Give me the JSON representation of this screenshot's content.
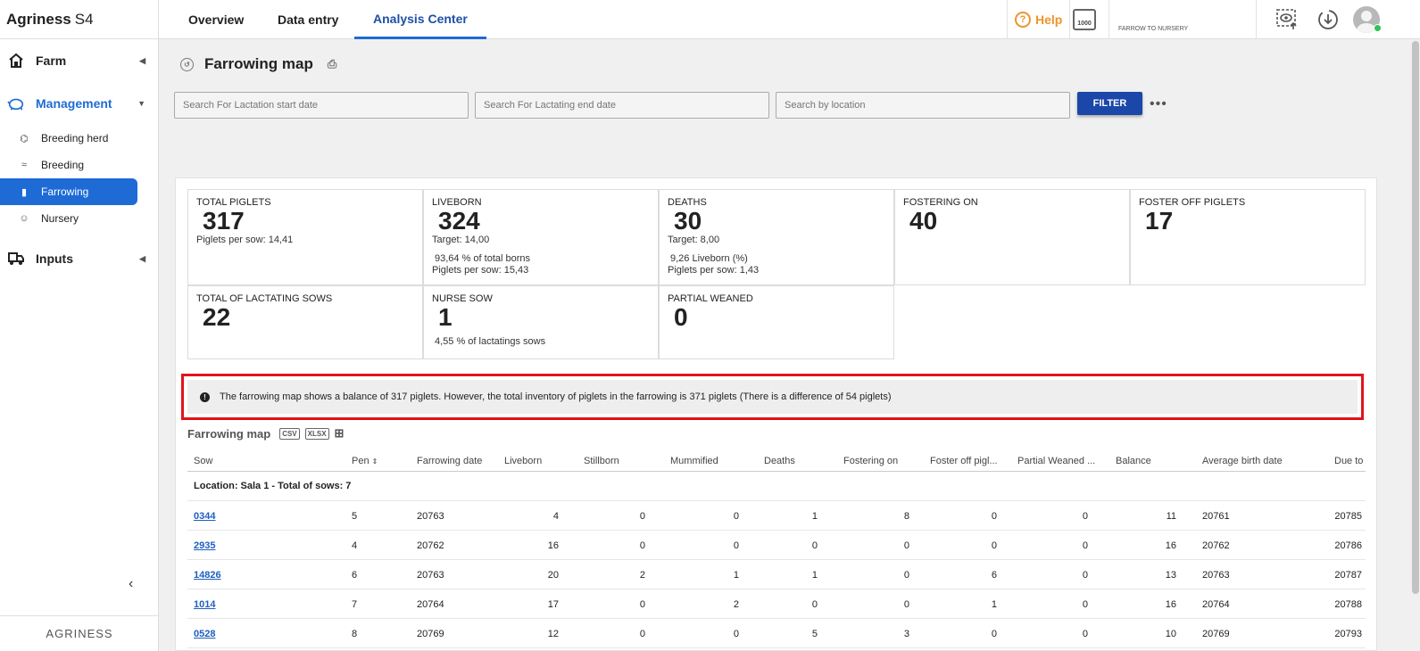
{
  "app": {
    "brand_bold": "Agriness",
    "brand_rest": "S4",
    "footer_logo": "AGRINESS"
  },
  "sidebar": {
    "groups": [
      {
        "label": "Farm",
        "icon": "house-icon"
      },
      {
        "label": "Management",
        "icon": "piggy-bank-icon"
      },
      {
        "label": "Inputs",
        "icon": "truck-icon"
      }
    ],
    "items": [
      {
        "label": "Breeding herd",
        "icon": "pig-icon"
      },
      {
        "label": "Breeding",
        "icon": "wave-icon"
      },
      {
        "label": "Farrowing",
        "icon": "bottle-icon"
      },
      {
        "label": "Nursery",
        "icon": "piglet-face-icon"
      }
    ]
  },
  "topbar": {
    "tabs": [
      "Overview",
      "Data entry",
      "Analysis Center"
    ],
    "help_label": "Help",
    "calendar_label": "1000",
    "farm_sub": "FARROW TO NURSERY"
  },
  "page": {
    "title": "Farrowing map"
  },
  "filters": {
    "start_placeholder": "Search For Lactation start date",
    "end_placeholder": "Search For Lactating end date",
    "location_placeholder": "Search by location",
    "filter_label": "FILTER",
    "more_label": "•••"
  },
  "cards": {
    "total_piglets": {
      "label": "TOTAL PIGLETS",
      "value": "317",
      "sub": "Piglets per sow:  14,41"
    },
    "liveborn": {
      "label": "LIVEBORN",
      "value": "324",
      "target": "Target:  14,00",
      "line1": "93,64 % of total borns",
      "line2": "Piglets per sow:  15,43"
    },
    "deaths": {
      "label": "DEATHS",
      "value": "30",
      "target": "Target:  8,00",
      "line1": "9,26 Liveborn (%)",
      "line2": "Piglets per sow:  1,43"
    },
    "fostering_on": {
      "label": "FOSTERING ON",
      "value": "40"
    },
    "foster_off": {
      "label": "FOSTER OFF PIGLETS",
      "value": "17"
    },
    "lactating_sows": {
      "label": "TOTAL OF LACTATING SOWS",
      "value": "22"
    },
    "nurse_sow": {
      "label": "NURSE SOW",
      "value": "1",
      "line1": "4,55 % of lactatings sows"
    },
    "partial_weaned": {
      "label": "PARTIAL WEANED",
      "value": "0"
    }
  },
  "alert": {
    "text": "The farrowing map shows a balance of 317 piglets. However, the total inventory of piglets in the farrowing is 371 piglets (There is a difference of 54 piglets)"
  },
  "table": {
    "title": "Farrowing map",
    "export_csv": "CSV",
    "export_xlsx": "XLSX",
    "columns": [
      "Sow",
      "Pen",
      "Farrowing date",
      "Liveborn",
      "Stillborn",
      "Mummified",
      "Deaths",
      "Fostering on",
      "Foster off pigl...",
      "Partial Weaned ...",
      "Balance",
      "Average birth date",
      "Due to"
    ],
    "group_label": "Location: Sala 1 - Total of sows: 7",
    "rows": [
      [
        "0344",
        "5",
        "20763",
        "4",
        "0",
        "0",
        "1",
        "8",
        "0",
        "0",
        "11",
        "20761",
        "20785"
      ],
      [
        "2935",
        "4",
        "20762",
        "16",
        "0",
        "0",
        "0",
        "0",
        "0",
        "0",
        "16",
        "20762",
        "20786"
      ],
      [
        "14826",
        "6",
        "20763",
        "20",
        "2",
        "1",
        "1",
        "0",
        "6",
        "0",
        "13",
        "20763",
        "20787"
      ],
      [
        "1014",
        "7",
        "20764",
        "17",
        "0",
        "2",
        "0",
        "0",
        "1",
        "0",
        "16",
        "20764",
        "20788"
      ],
      [
        "0528",
        "8",
        "20769",
        "12",
        "0",
        "0",
        "5",
        "3",
        "0",
        "0",
        "10",
        "20769",
        "20793"
      ]
    ]
  },
  "colors": {
    "accent": "#1e6bd6",
    "filter_button": "#1a47a8",
    "help": "#f0932b",
    "alert_border": "#e0141b",
    "online": "#2ec45a"
  }
}
